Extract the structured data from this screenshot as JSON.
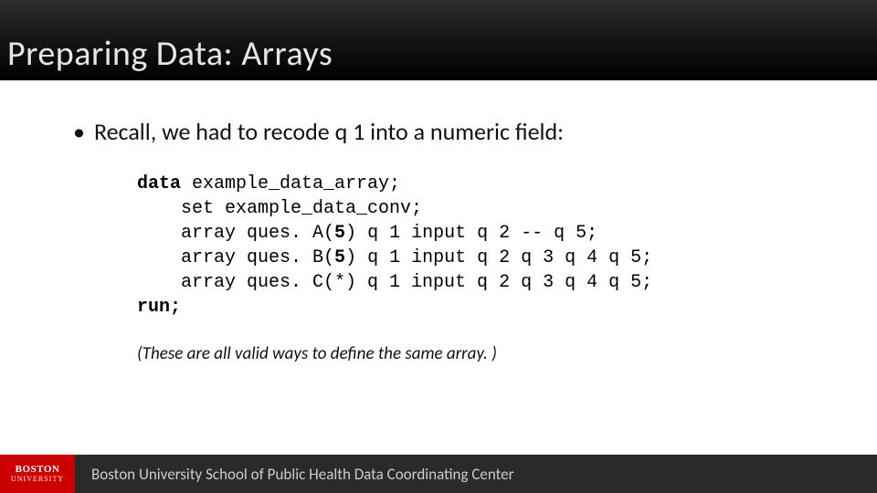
{
  "title": "Preparing Data: Arrays",
  "bullet": "Recall, we had to recode q 1 into a numeric field:",
  "code": {
    "l1_kw": "data",
    "l1_rest": " example_data_array;",
    "l2": "    set example_data_conv;",
    "l3a": "    array ques. A(",
    "l3b": "5",
    "l3c": ") q 1 input q 2 -- q 5;",
    "l4a": "    array ques. B(",
    "l4b": "5",
    "l4c": ") q 1 input q 2 q 3 q 4 q 5;",
    "l5": "    array ques. C(*) q 1 input q 2 q 3 q 4 q 5;",
    "l6": "run;"
  },
  "note": "(These are all valid ways to define the same array. )",
  "footer": {
    "logo_top": "BOSTON",
    "logo_bottom": "UNIVERSITY",
    "text": "Boston University School of Public Health Data Coordinating Center"
  }
}
